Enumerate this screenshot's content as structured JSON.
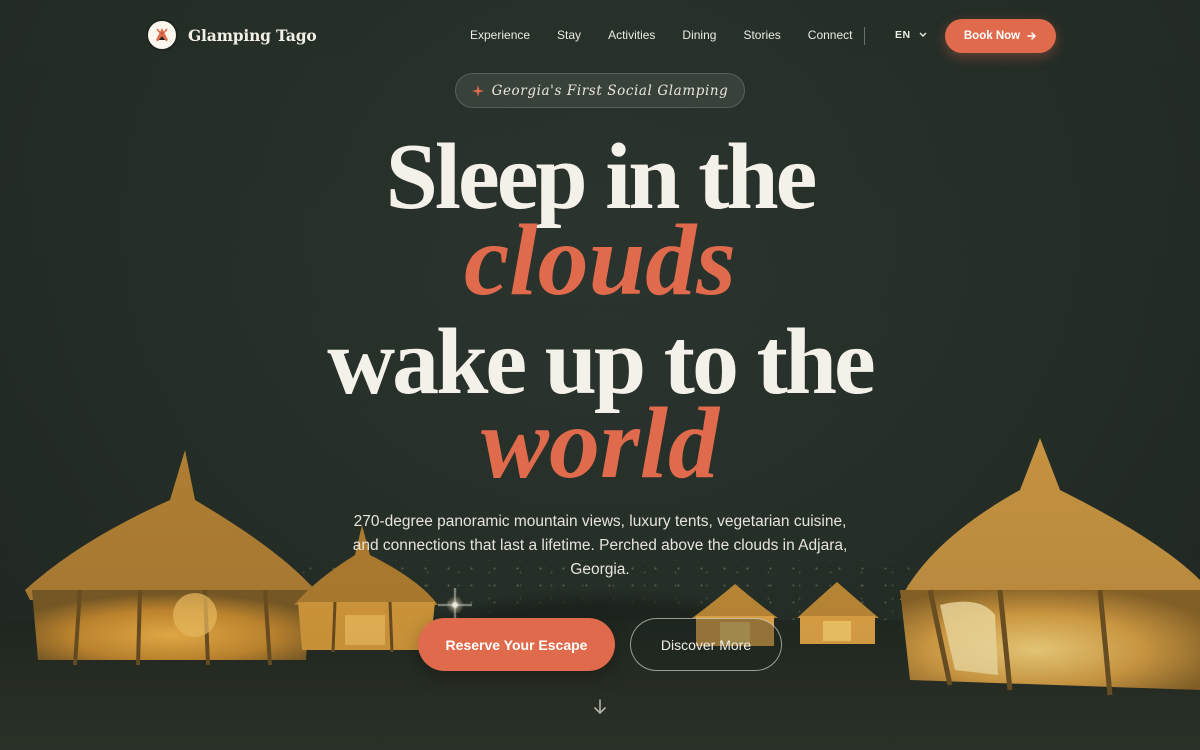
{
  "header": {
    "brand_name": "Glamping Tago",
    "logo_icon": "tent-logo-icon",
    "nav": [
      {
        "label": "Experience"
      },
      {
        "label": "Stay"
      },
      {
        "label": "Activities"
      },
      {
        "label": "Dining"
      },
      {
        "label": "Stories"
      },
      {
        "label": "Connect"
      }
    ],
    "language": "EN",
    "language_icon": "chevron-down-icon",
    "book_label": "Book Now",
    "book_icon": "arrow-right-icon"
  },
  "hero": {
    "badge_icon": "sparkle-icon",
    "badge_text": "Georgia's First Social Glamping",
    "headline": {
      "line1": "Sleep in the",
      "line2": "clouds",
      "line3": "wake up to the",
      "line4": "world"
    },
    "subtitle": "270-degree panoramic mountain views, luxury tents, vegetarian cuisine, and connections that last a lifetime. Perched above the clouds in Adjara, Georgia.",
    "cta_primary": "Reserve Your Escape",
    "cta_secondary": "Discover More",
    "scroll_icon": "arrow-down-icon"
  },
  "colors": {
    "accent": "#e06b4c",
    "background": "#273029",
    "text": "#f3f1ea"
  }
}
